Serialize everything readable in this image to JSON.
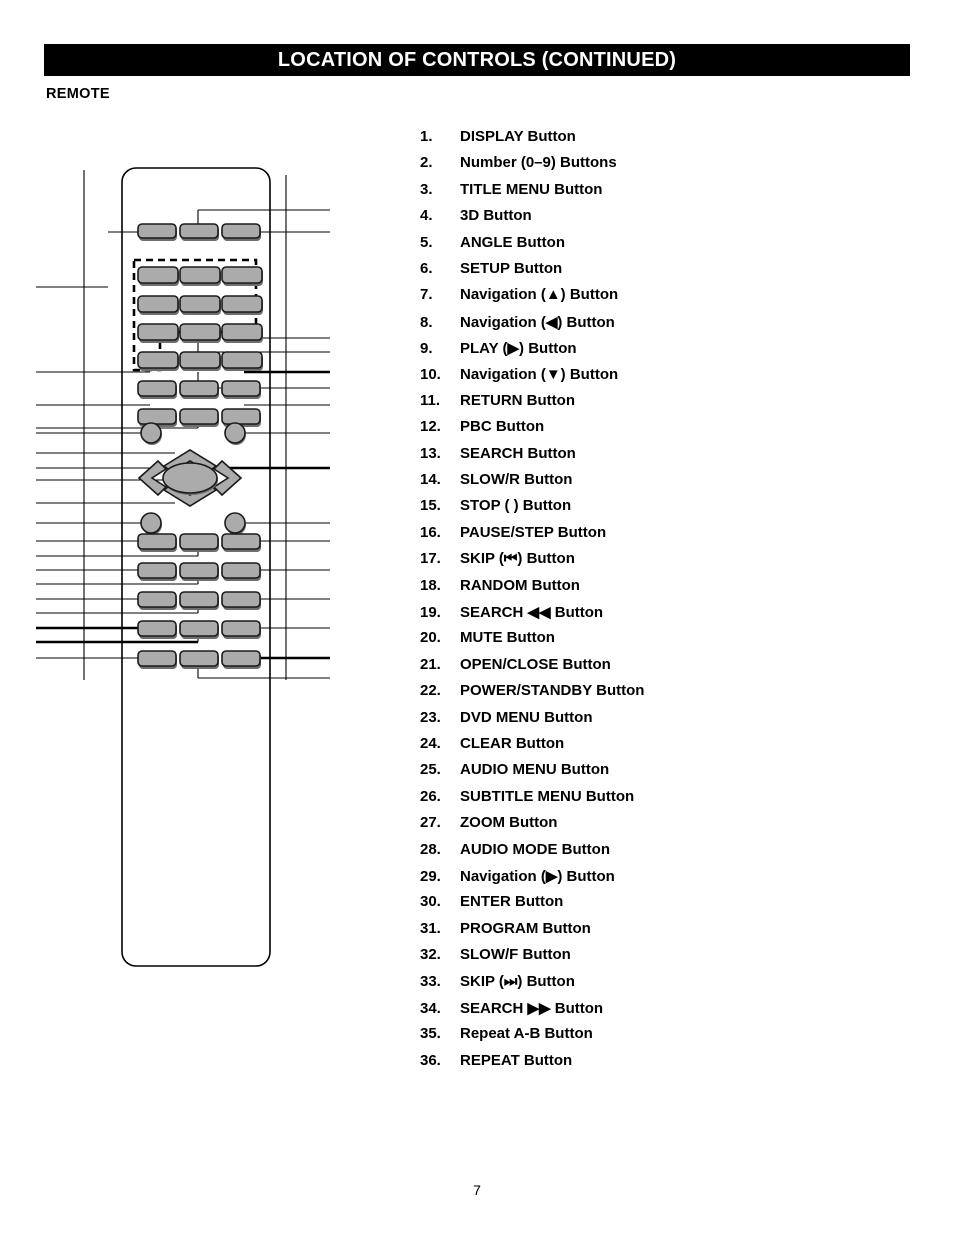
{
  "header": {
    "title": "LOCATION OF CONTROLS (CONTINUED)"
  },
  "section": {
    "label": "REMOTE"
  },
  "controls_list": [
    {
      "num": "1.",
      "text": "DISPLAY Button"
    },
    {
      "num": "2.",
      "text": "Number (0–9) Buttons"
    },
    {
      "num": "3.",
      "text": "TITLE MENU Button"
    },
    {
      "num": "4.",
      "text": "3D Button"
    },
    {
      "num": "5.",
      "text": "ANGLE Button"
    },
    {
      "num": "6.",
      "text": "SETUP Button"
    },
    {
      "num": "7.",
      "text": "Navigation (▲) Button"
    },
    {
      "num": "8.",
      "text": "Navigation (◀) Button"
    },
    {
      "num": "9.",
      "text": "PLAY (▶) Button"
    },
    {
      "num": "10.",
      "text": "Navigation (▼) Button"
    },
    {
      "num": "11.",
      "text": "RETURN Button"
    },
    {
      "num": "12.",
      "text": "PBC Button"
    },
    {
      "num": "13.",
      "text": "SEARCH Button"
    },
    {
      "num": "14.",
      "text": "SLOW/R Button"
    },
    {
      "num": "15.",
      "text": "STOP (  ) Button"
    },
    {
      "num": "16.",
      "text": "PAUSE/STEP Button"
    },
    {
      "num": "17.",
      "text": "SKIP  (⏮) Button"
    },
    {
      "num": "18.",
      "text": "RANDOM Button"
    },
    {
      "num": "19.",
      "text": "SEARCH ◀◀ Button"
    },
    {
      "num": "20.",
      "text": "MUTE Button"
    },
    {
      "num": "21.",
      "text": "OPEN/CLOSE Button"
    },
    {
      "num": "22.",
      "text": "POWER/STANDBY Button"
    },
    {
      "num": "23.",
      "text": "DVD MENU Button"
    },
    {
      "num": "24.",
      "text": "CLEAR Button"
    },
    {
      "num": "25.",
      "text": "AUDIO MENU Button"
    },
    {
      "num": "26.",
      "text": "SUBTITLE MENU Button"
    },
    {
      "num": "27.",
      "text": "ZOOM Button"
    },
    {
      "num": "28.",
      "text": "AUDIO MODE Button"
    },
    {
      "num": "29.",
      "text": "Navigation (▶) Button"
    },
    {
      "num": "30.",
      "text": "ENTER Button"
    },
    {
      "num": "31.",
      "text": "PROGRAM Button"
    },
    {
      "num": "32.",
      "text": "SLOW/F Button"
    },
    {
      "num": "33.",
      "text": "SKIP (⏭) Button"
    },
    {
      "num": "34.",
      "text": "SEARCH ▶▶ Button"
    },
    {
      "num": "35.",
      "text": "Repeat A-B Button"
    },
    {
      "num": "36.",
      "text": "REPEAT Button"
    }
  ],
  "diagram": {
    "name": "remote-control-diagram",
    "body_fill": "#ffffff",
    "button_fill": "#ababab",
    "outline_color": "#000000",
    "keypad_group_style": "dashed",
    "dpad": {
      "center_button": "enter",
      "directions": [
        "up",
        "left",
        "right",
        "down"
      ]
    },
    "corner_buttons": [
      "top-left-round",
      "top-right-round",
      "bottom-left-round",
      "bottom-right-round"
    ]
  },
  "footer": {
    "page_number": "7"
  }
}
